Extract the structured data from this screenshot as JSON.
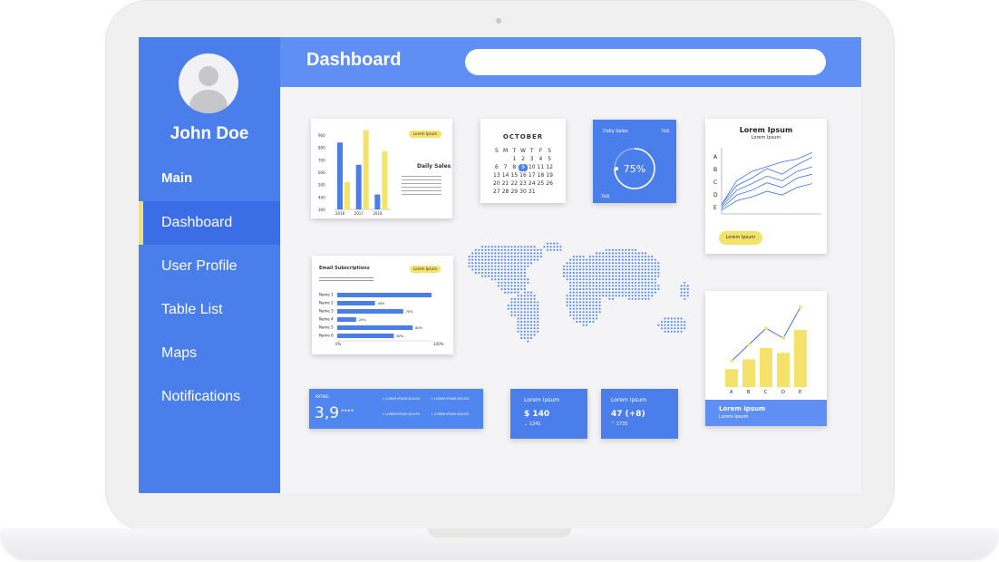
{
  "sidebar": {
    "user_name": "John Doe",
    "section": "Main",
    "items": [
      {
        "label": "Dashboard"
      },
      {
        "label": "User Profile"
      },
      {
        "label": "Table List"
      },
      {
        "label": "Maps"
      },
      {
        "label": "Notifications"
      }
    ]
  },
  "header": {
    "title": "Dashboard"
  },
  "widgets": {
    "bar_card": {
      "tag": "Lorem Ipsum",
      "title": "Daily Sales",
      "yticks": [
        "900",
        "800",
        "700",
        "600",
        "500",
        "400",
        "300"
      ],
      "xticks": [
        "2016",
        "2017",
        "2018"
      ]
    },
    "calendar": {
      "title": "OCTOBER",
      "weekdays": [
        "S",
        "M",
        "T",
        "W",
        "T",
        "F",
        "S"
      ],
      "days": [
        "",
        "",
        "1",
        "2",
        "3",
        "4",
        "5",
        "6",
        "7",
        "8",
        "9",
        "10",
        "11",
        "12",
        "13",
        "14",
        "15",
        "16",
        "17",
        "18",
        "19",
        "20",
        "21",
        "22",
        "23",
        "24",
        "25",
        "26",
        "27",
        "28",
        "29",
        "30",
        "31",
        "",
        "",
        ""
      ],
      "highlight": "9"
    },
    "daily_sales": {
      "title": "Daily Sales",
      "corner": "76/8",
      "percent": "75%",
      "footer": "76/8"
    },
    "line_card": {
      "title": "Lorem Ipsum",
      "subtitle": "Lorem Ipsum",
      "labels": [
        "A",
        "B",
        "C",
        "D",
        "E"
      ],
      "tag": "Lorem Ipsum"
    },
    "email_card": {
      "title": "Email Subscriptions",
      "tag": "Lorem Ipsum",
      "rows": [
        {
          "name": "Name 1",
          "value": ""
        },
        {
          "name": "Name 2",
          "value": "40%"
        },
        {
          "name": "Name 3",
          "value": "70%"
        },
        {
          "name": "Name 4",
          "value": "20%"
        },
        {
          "name": "Name 5",
          "value": "80%"
        },
        {
          "name": "Name 6",
          "value": "60%"
        }
      ],
      "axis_start": "0%",
      "axis_end": "100%"
    },
    "rating_card": {
      "label": "RATING",
      "value": "3,9",
      "stars": "★★★★",
      "items": [
        "+ LOREM IPSUM DOLOR",
        "+ LOREM IPSUM DOLOR",
        "+ LOREM IPSUM DOLOR",
        "+ LOREM IPSUM DOLOR"
      ]
    },
    "price_card": {
      "label": "Lorem Ipsum",
      "value": "$ 140",
      "sub": "⌄ 1241"
    },
    "count_card": {
      "label": "Lorem Ipsum",
      "value": "47 (+8)",
      "sub": "^ 1735"
    },
    "bar2_card": {
      "labels": [
        "A",
        "B",
        "C",
        "D",
        "E"
      ],
      "title": "Lorem Ipsum",
      "subtitle": "Lorem Ipsum"
    }
  },
  "colors": {
    "primary": "#4a7eea",
    "header": "#5f8ff4",
    "accent": "#f5e26a"
  },
  "chart_data": [
    {
      "type": "bar",
      "title": "Daily Sales",
      "categories": [
        "2016",
        "2017",
        "2018"
      ],
      "series": [
        {
          "values": [
            840,
            660,
            420
          ]
        },
        {
          "values": [
            520,
            940,
            770
          ]
        }
      ],
      "ylim": [
        300,
        900
      ]
    },
    {
      "type": "line",
      "title": "Lorem Ipsum",
      "x": [
        0,
        1,
        2,
        3,
        4,
        5,
        6
      ],
      "series": [
        {
          "values": [
            10,
            35,
            45,
            50,
            55,
            58,
            65
          ]
        },
        {
          "values": [
            10,
            30,
            38,
            48,
            42,
            52,
            60
          ]
        },
        {
          "values": [
            8,
            25,
            32,
            40,
            35,
            45,
            50
          ]
        },
        {
          "values": [
            6,
            20,
            25,
            33,
            28,
            38,
            42
          ]
        },
        {
          "values": [
            4,
            14,
            18,
            24,
            20,
            28,
            32
          ]
        }
      ]
    },
    {
      "type": "bar",
      "categories": [
        "A",
        "B",
        "C",
        "D",
        "E"
      ],
      "values": [
        22,
        34,
        48,
        42,
        70
      ],
      "line": [
        32,
        52,
        72,
        60,
        98
      ]
    },
    {
      "type": "bar",
      "title": "Email Subscriptions",
      "categories": [
        "Name 1",
        "Name 2",
        "Name 3",
        "Name 4",
        "Name 5",
        "Name 6"
      ],
      "values": [
        100,
        40,
        70,
        20,
        80,
        60
      ]
    }
  ]
}
